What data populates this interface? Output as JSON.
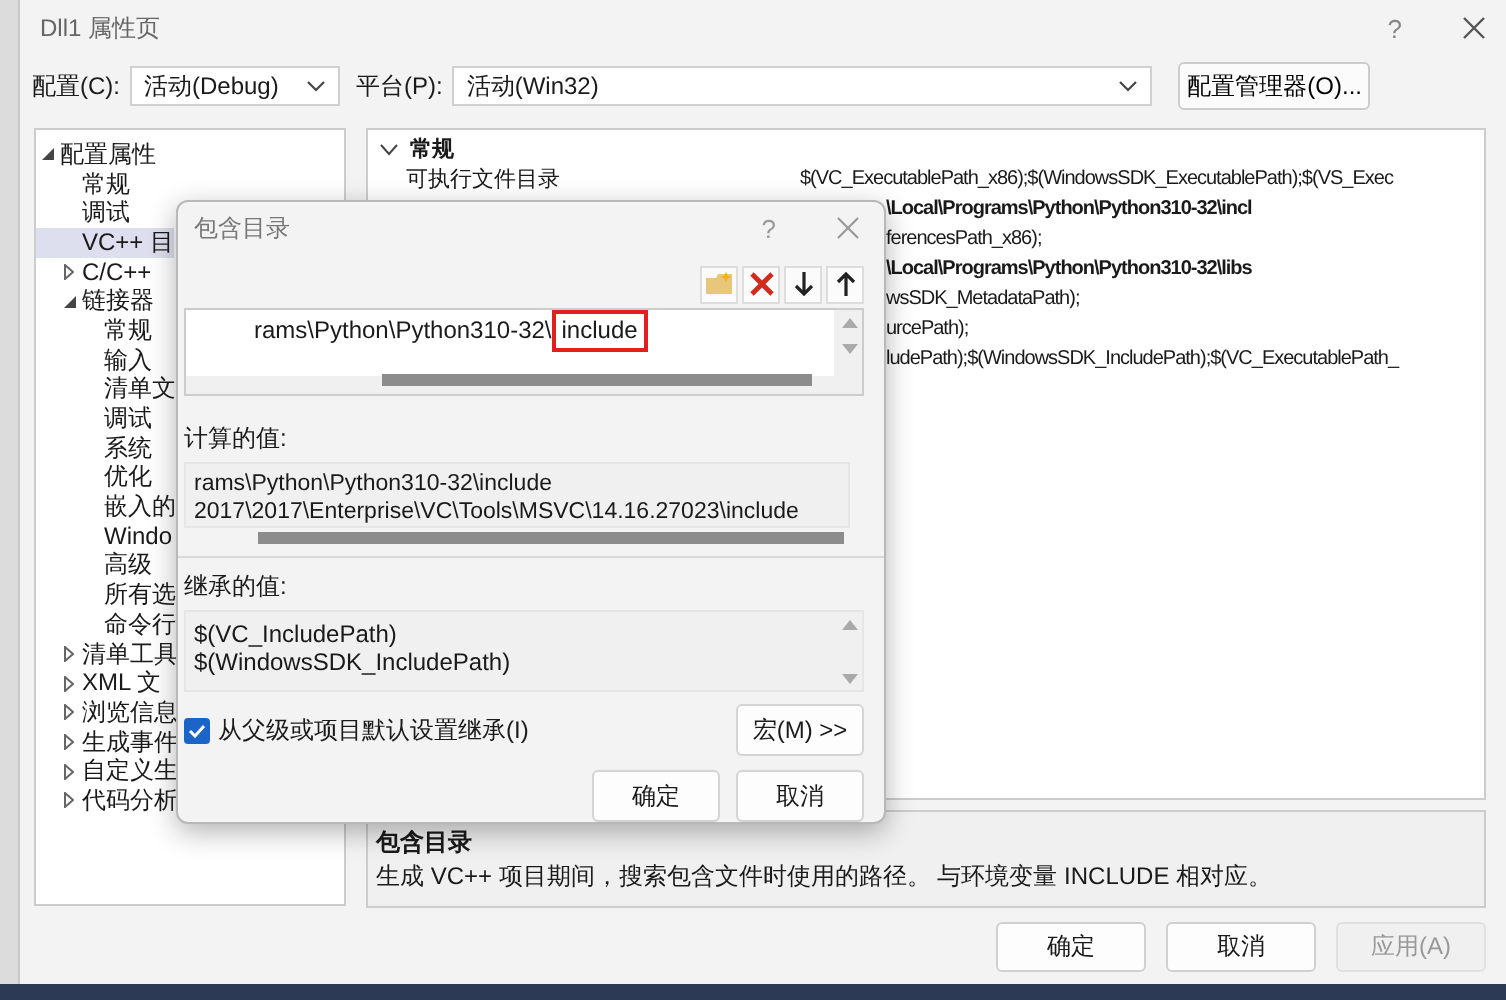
{
  "window": {
    "title": "Dll1 属性页",
    "help": "?"
  },
  "config": [
    {
      "label": "配置(C):",
      "value": "活动(Debug)"
    },
    {
      "label": "平台(P):",
      "value": "活动(Win32)"
    }
  ],
  "config_manager_button": "配置管理器(O)...",
  "tree": {
    "items": [
      {
        "label": "配置属性",
        "expanded": true,
        "selected": false,
        "children": [
          {
            "label": "常规",
            "selected": false
          },
          {
            "label": "调试",
            "selected": false
          },
          {
            "label": "VC++ 目",
            "selected": true
          },
          {
            "label": "C/C++",
            "expanded": false,
            "selected": false
          },
          {
            "label": "链接器",
            "expanded": true,
            "selected": false,
            "children": [
              {
                "label": "常规",
                "selected": false
              },
              {
                "label": "输入",
                "selected": false
              },
              {
                "label": "清单文",
                "selected": false
              },
              {
                "label": "调试",
                "selected": false
              },
              {
                "label": "系统",
                "selected": false
              },
              {
                "label": "优化",
                "selected": false
              },
              {
                "label": "嵌入的",
                "selected": false
              },
              {
                "label": "Windo",
                "selected": false
              },
              {
                "label": "高级",
                "selected": false
              },
              {
                "label": "所有选",
                "selected": false
              },
              {
                "label": "命令行",
                "selected": false
              }
            ]
          },
          {
            "label": "清单工具",
            "expanded": false,
            "selected": false
          },
          {
            "label": "XML 文",
            "expanded": false,
            "selected": false
          },
          {
            "label": "浏览信息",
            "expanded": false,
            "selected": false
          },
          {
            "label": "生成事件",
            "expanded": false,
            "selected": false
          },
          {
            "label": "自定义生",
            "expanded": false,
            "selected": false
          },
          {
            "label": "代码分析",
            "expanded": false,
            "selected": false
          }
        ]
      }
    ]
  },
  "grid": {
    "category": {
      "label": "常规",
      "expanded": true
    },
    "rows": [
      {
        "name": "可执行文件目录",
        "value": "$(VC_ExecutablePath_x86);$(WindowsSDK_ExecutablePath);$(VS_Exec",
        "modified": false
      },
      {
        "value": "\\Local\\Programs\\Python\\Python310-32\\incl",
        "modified": true
      },
      {
        "value": "ferencesPath_x86);",
        "modified": false
      },
      {
        "value": "\\Local\\Programs\\Python\\Python310-32\\libs",
        "modified": true
      },
      {
        "value": "wsSDK_MetadataPath);",
        "modified": false
      },
      {
        "value": "urcePath);",
        "modified": false
      },
      {
        "value": "ludePath);$(WindowsSDK_IncludePath);$(VC_ExecutablePath_",
        "modified": false
      }
    ]
  },
  "description": {
    "title": "包含目录",
    "text": "生成 VC++ 项目期间，搜索包含文件时使用的路径。 与环境变量 INCLUDE 相对应。"
  },
  "buttons": [
    {
      "label": "确定",
      "disabled": false
    },
    {
      "label": "取消",
      "disabled": false
    },
    {
      "label": "应用(A)",
      "disabled": true
    }
  ],
  "dialog": {
    "title": "包含目录",
    "help": "?",
    "list": {
      "text": "rams\\Python\\Python310-32\\",
      "highlighted": "include"
    },
    "computed_label": "计算的值:",
    "computed_lines": [
      "rams\\Python\\Python310-32\\include",
      "2017\\2017\\Enterprise\\VC\\Tools\\MSVC\\14.16.27023\\include"
    ],
    "inherited_label": "继承的值:",
    "inherited_lines": [
      "$(VC_IncludePath)",
      "$(WindowsSDK_IncludePath)"
    ],
    "inherit": {
      "label": "从父级或项目默认设置继承(I)",
      "checked": true
    },
    "macro_button": "宏(M) >>",
    "buttons": [
      "确定",
      "取消"
    ]
  }
}
